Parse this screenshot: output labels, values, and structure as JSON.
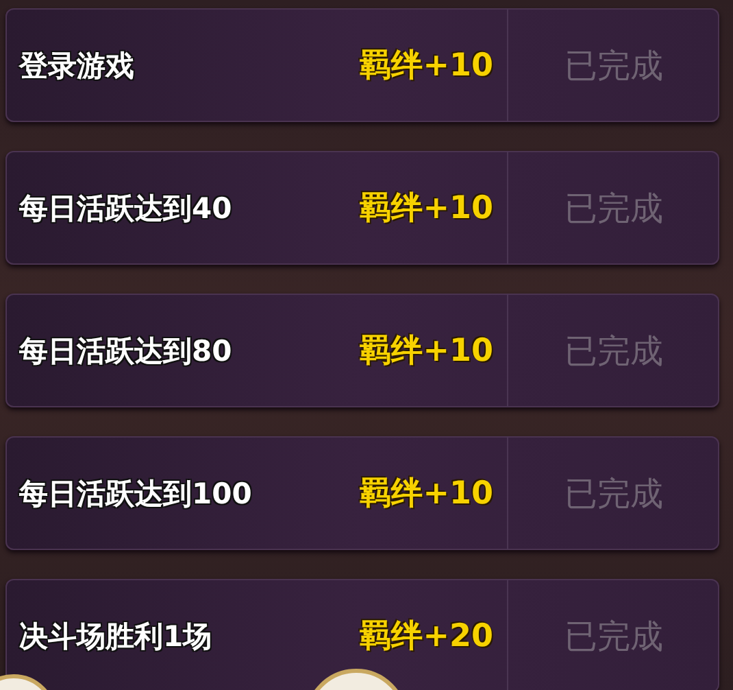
{
  "tasks": [
    {
      "title": "登录游戏",
      "reward": "羁绊+10",
      "status": "已完成",
      "completed": true
    },
    {
      "title": "每日活跃达到40",
      "reward": "羁绊+10",
      "status": "已完成",
      "completed": true
    },
    {
      "title": "每日活跃达到80",
      "reward": "羁绊+10",
      "status": "已完成",
      "completed": true
    },
    {
      "title": "每日活跃达到100",
      "reward": "羁绊+10",
      "status": "已完成",
      "completed": true
    },
    {
      "title": "决斗场胜利1场",
      "reward": "羁绊+20",
      "status": "已完成",
      "completed": true
    }
  ]
}
